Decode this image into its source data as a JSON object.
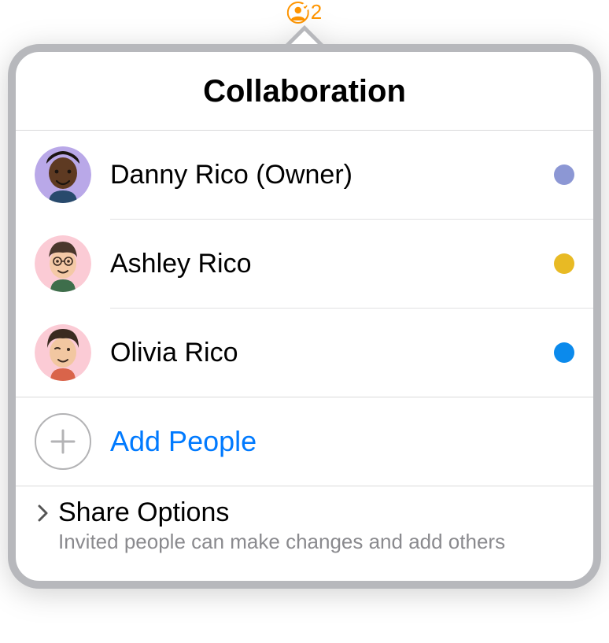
{
  "accent": "#FF9500",
  "toolbar": {
    "collaborator_count": "2"
  },
  "popover": {
    "title": "Collaboration",
    "participants": [
      {
        "name": "Danny Rico (Owner)",
        "dot_color": "#8C97D4",
        "avatar_bg": "#B9A8E8",
        "skin": "#5E3A22",
        "hair": "#1B1410"
      },
      {
        "name": "Ashley Rico",
        "dot_color": "#E8BA24",
        "avatar_bg": "#FBCBD5",
        "skin": "#F4C9A6",
        "hair": "#4A372C"
      },
      {
        "name": "Olivia Rico",
        "dot_color": "#0B8AEC",
        "avatar_bg": "#FBCBD5",
        "skin": "#F2C7A1",
        "hair": "#3A2A20"
      }
    ],
    "add_people_label": "Add People",
    "share": {
      "title": "Share Options",
      "subtitle": "Invited people can make changes and add others"
    }
  }
}
